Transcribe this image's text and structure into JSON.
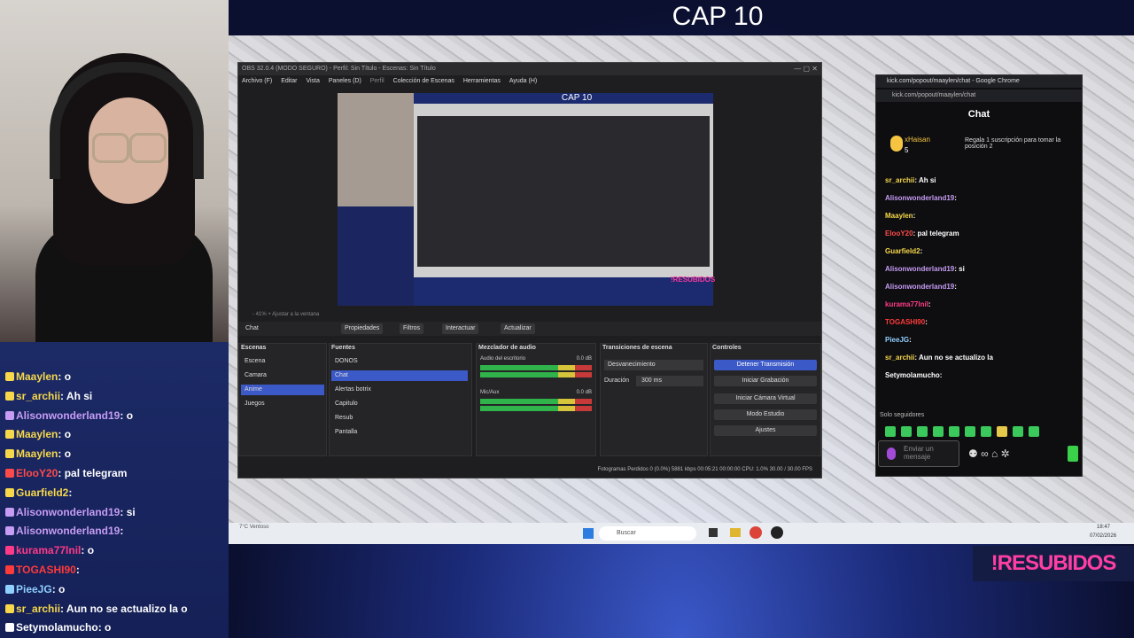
{
  "stream": {
    "title": "CAP 10",
    "overlay_label": "!RESUBIDOS"
  },
  "left_chat": [
    {
      "user": "Maaylen",
      "text": ": o",
      "color": "#f7d84a"
    },
    {
      "user": "sr_archii",
      "text": ": Ah si",
      "color": "#f7d84a"
    },
    {
      "user": "Alisonwonderland19",
      "text": ": o",
      "color": "#c69cf4"
    },
    {
      "user": "Maaylen",
      "text": ": o",
      "color": "#f7d84a"
    },
    {
      "user": "Maaylen",
      "text": ": o",
      "color": "#f7d84a"
    },
    {
      "user": "ElooY20",
      "text": ": pal telegram",
      "color": "#ff4a4a"
    },
    {
      "user": "Guarfield2",
      "text": ":",
      "color": "#f7d84a"
    },
    {
      "user": "Alisonwonderland19",
      "text": ": si",
      "color": "#c69cf4"
    },
    {
      "user": "Alisonwonderland19",
      "text": ":",
      "color": "#c69cf4"
    },
    {
      "user": "kurama77lnil",
      "text": ": o",
      "color": "#ff3a88"
    },
    {
      "user": "TOGASHI90",
      "text": ":",
      "color": "#ff3a3a"
    },
    {
      "user": "PieeJG",
      "text": ": o",
      "color": "#8fd0ff"
    },
    {
      "user": "sr_archii",
      "text": ": Aun no se actualizo la o",
      "color": "#f7d84a"
    },
    {
      "user": "Setymolamucho",
      "text": ": o",
      "color": "#ffffff"
    }
  ],
  "obs": {
    "title": "OBS 32.0.4 (MODO SEGURO) - Perfil: Sin Título - Escenas: Sin Título",
    "menu": [
      "Archivo (F)",
      "Editar",
      "Vista",
      "Paneles (D)",
      "Perfil",
      "Colección de Escenas",
      "Herramientas",
      "Ayuda (H)"
    ],
    "preview_bottom": "- 41% + Ajustar a la ventana",
    "source_label": "Chat",
    "source_buttons": [
      "Propiedades",
      "Filtros",
      "Interactuar",
      "Actualizar"
    ],
    "docks": {
      "scenes_title": "Escenas",
      "scenes": [
        "Escena",
        "Camara",
        "Anime",
        "Juegos"
      ],
      "selected_scene": 2,
      "sources_title": "Fuentes",
      "sources": [
        "DONOS",
        "Chat",
        "Alertas botrix",
        "Capitulo",
        "Resub",
        "Pantalla"
      ],
      "selected_source": 1,
      "mixer_title": "Mezclador de audio",
      "mixer": [
        {
          "name": "Audio del escritorio",
          "db": "0.0 dB"
        },
        {
          "name": "Mic/Aux",
          "db": "0.0 dB"
        }
      ],
      "transitions_title": "Transiciones de escena",
      "transition_value": "Desvanecimiento",
      "duration_label": "Duración",
      "duration_value": "300 ms",
      "controls_title": "Controles",
      "controls": [
        "Detener Transmisión",
        "Iniciar Grabación",
        "Iniciar Cámara Virtual",
        "Modo Estudio",
        "Ajustes"
      ]
    },
    "status": "Fotogramas Perdidos 0 (0.0%)    5881 kbps    00:05:21    00:00:00    CPU: 1.0%    30.00 / 30.00 FPS"
  },
  "chrome": {
    "title": "kick.com/popout/maaylen/chat - Google Chrome",
    "url": "kick.com/popout/maaylen/chat",
    "chat_title": "Chat",
    "pinned_user": "xHaisan",
    "pinned_count": "5",
    "pinned_text": "Regala 1 suscripción para tomar la posición 2",
    "messages": [
      {
        "user": "sr_archii",
        "text": ": Ah si",
        "color": "#f7d84a"
      },
      {
        "user": "Alisonwonderland19",
        "text": ":",
        "color": "#c69cf4"
      },
      {
        "user": "Maaylen",
        "text": ":",
        "color": "#f7d84a"
      },
      {
        "user": "ElooY20",
        "text": ": pal telegram",
        "color": "#ff4a4a"
      },
      {
        "user": "Guarfield2",
        "text": ":",
        "color": "#f7d84a"
      },
      {
        "user": "Alisonwonderland19",
        "text": ": si",
        "color": "#c69cf4"
      },
      {
        "user": "Alisonwonderland19",
        "text": ":",
        "color": "#c69cf4"
      },
      {
        "user": "kurama77lnil",
        "text": ":",
        "color": "#ff3a88"
      },
      {
        "user": "TOGASHI90",
        "text": ":",
        "color": "#ff3a3a"
      },
      {
        "user": "PieeJG",
        "text": ":",
        "color": "#8fd0ff"
      },
      {
        "user": "sr_archii",
        "text": ": Aun no se actualizo la",
        "color": "#f7d84a"
      },
      {
        "user": "Setymolamucho",
        "text": ":",
        "color": "#ffffff"
      }
    ],
    "followers_only": "Solo seguidores",
    "input_placeholder": "Enviar un mensaje"
  },
  "taskbar": {
    "weather": "7°C Ventoso",
    "search": "Buscar",
    "time": "18:47",
    "date": "07/02/2026"
  }
}
